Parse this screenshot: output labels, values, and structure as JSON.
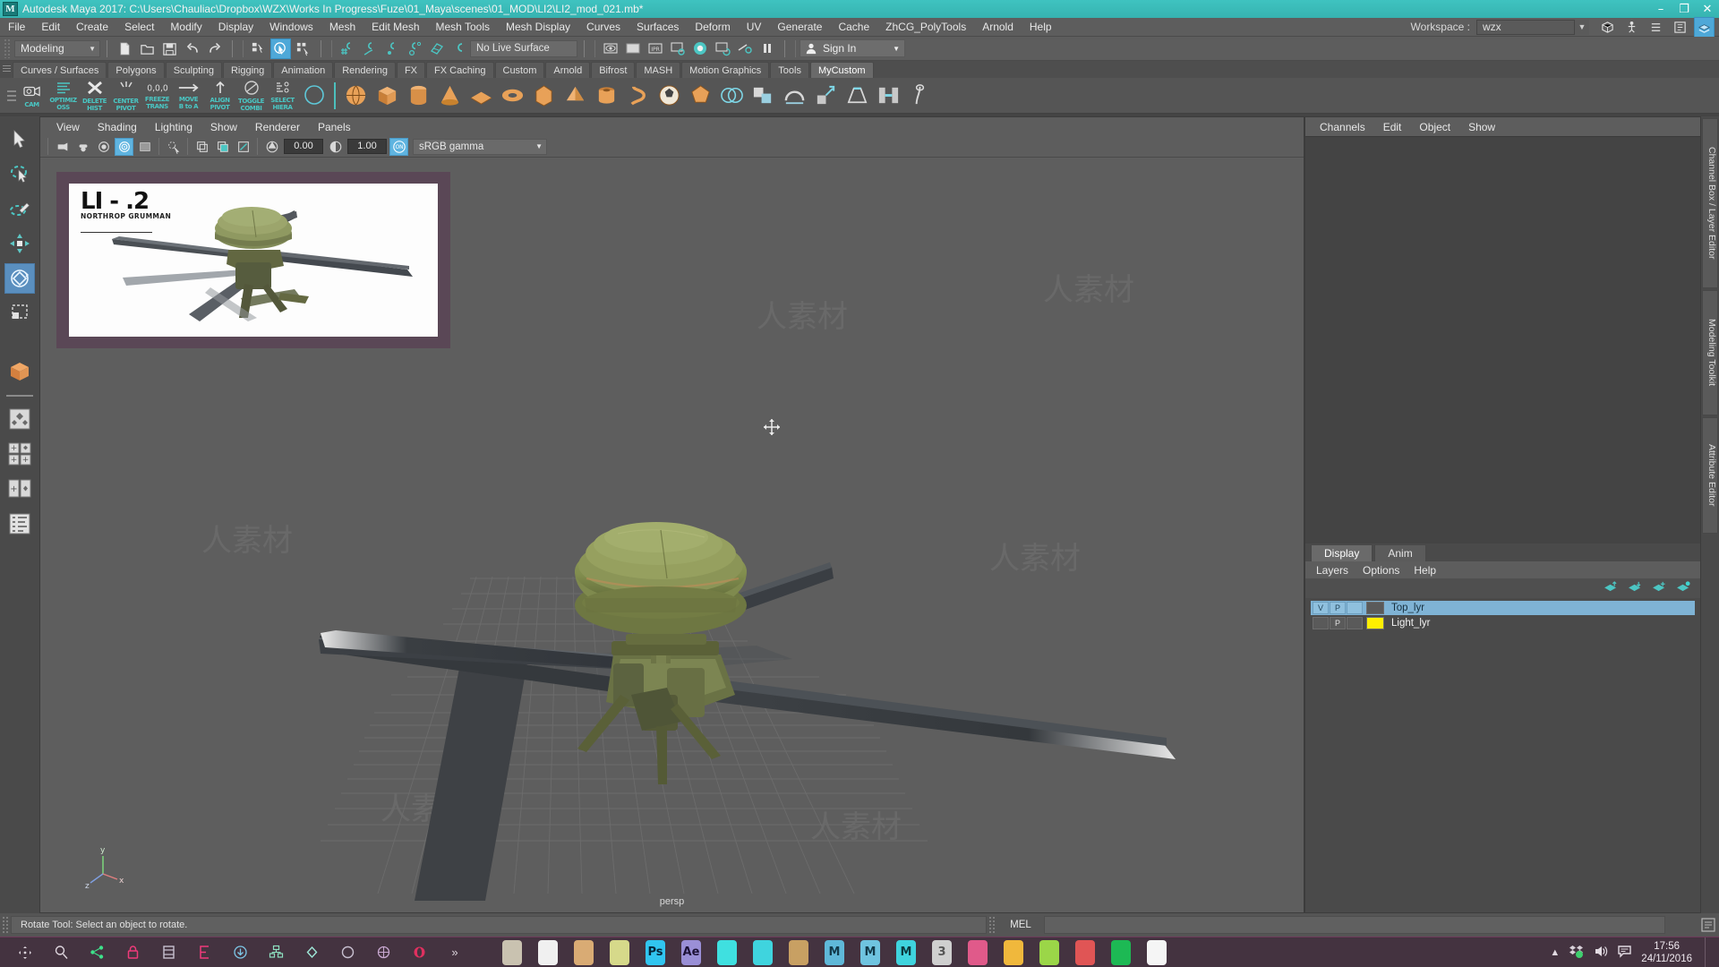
{
  "window": {
    "title": "Autodesk Maya 2017: C:\\Users\\Chauliac\\Dropbox\\WZX\\Works In Progress\\Fuze\\01_Maya\\scenes\\01_MOD\\LI2\\LI2_mod_021.mb*",
    "logo": "M",
    "minimize": "–",
    "maximize": "❐",
    "close": "✕",
    "titlebar_color": "#3cc0bd"
  },
  "menubar": {
    "items": [
      "File",
      "Edit",
      "Create",
      "Select",
      "Modify",
      "Display",
      "Windows",
      "Mesh",
      "Edit Mesh",
      "Mesh Tools",
      "Mesh Display",
      "Curves",
      "Surfaces",
      "Deform",
      "UV",
      "Generate",
      "Cache",
      "ZhCG_PolyTools",
      "Arnold",
      "Help"
    ],
    "workspace_label": "Workspace :",
    "workspace_value": "wzx"
  },
  "statusline": {
    "mode": "Modeling",
    "live_surface": "No Live Surface",
    "sign_in": "Sign In",
    "icons": [
      "new-scene-icon",
      "open-scene-icon",
      "save-scene-icon",
      "undo-icon",
      "redo-icon",
      "select-by-hierarchy-icon",
      "select-by-object-icon",
      "select-by-component-icon",
      "snap-to-grid-icon",
      "snap-to-curve-icon",
      "snap-to-point-icon",
      "snap-to-projected-center-icon",
      "snap-to-view-plane-icon",
      "make-live-icon",
      "render-view-icon",
      "render-region-icon",
      "ipr-render-icon",
      "render-settings-icon",
      "hypershade-icon",
      "render-sequence-icon",
      "toggle-render-icon",
      "pause-icon"
    ]
  },
  "shelf": {
    "tabs": [
      "Curves / Surfaces",
      "Polygons",
      "Sculpting",
      "Rigging",
      "Animation",
      "Rendering",
      "FX",
      "FX Caching",
      "Custom",
      "Arnold",
      "Bifrost",
      "MASH",
      "Motion Graphics",
      "Tools",
      "MyCustom"
    ],
    "active_tab": "MyCustom",
    "buttons": [
      {
        "name": "camera-shelf-button",
        "line1": "CAM",
        "line2": ""
      },
      {
        "name": "optimize-shelf-button",
        "line1": "OPTIMIZ",
        "line2": "OSS"
      },
      {
        "name": "delete-history-shelf-button",
        "line1": "DELETE",
        "line2": "HIST"
      },
      {
        "name": "center-pivot-shelf-button",
        "line1": "CENTER",
        "line2": "PIVOT"
      },
      {
        "name": "freeze-transform-shelf-button",
        "line1": "FREEZE",
        "line2": "TRANS"
      },
      {
        "name": "move-b-to-a-shelf-button",
        "line1": "MOVE",
        "line2": "B to A"
      },
      {
        "name": "align-pivot-shelf-button",
        "line1": "ALIGN",
        "line2": "PIVOT"
      },
      {
        "name": "toggle-combine-shelf-button",
        "line1": "TOGGLE",
        "line2": "COMBI"
      },
      {
        "name": "select-hierarchy-shelf-button",
        "line1": "SELECT",
        "line2": "HIERA"
      },
      {
        "name": "circle-shelf-button",
        "line1": "",
        "line2": ""
      }
    ],
    "primitives": [
      "sphere-icon",
      "cube-icon",
      "cylinder-icon",
      "cone-icon",
      "plane-icon",
      "torus-icon",
      "prism-icon",
      "pyramid-icon",
      "pipe-icon",
      "helix-icon",
      "soccer-ball-icon",
      "platonic-icon",
      "boolean-icon",
      "combine-icon",
      "smooth-icon",
      "extrude-icon",
      "bevel-icon",
      "bridge-icon",
      "sculpt-icon"
    ]
  },
  "toolbox": {
    "tools": [
      {
        "name": "select-tool",
        "icon": "arrow-cursor-icon",
        "selected": false
      },
      {
        "name": "lasso-select-tool",
        "icon": "lasso-icon",
        "selected": false
      },
      {
        "name": "paint-select-tool",
        "icon": "paint-brush-icon",
        "selected": false
      },
      {
        "name": "move-tool",
        "icon": "move-arrows-icon",
        "selected": false
      },
      {
        "name": "rotate-tool",
        "icon": "rotate-rings-icon",
        "selected": true
      },
      {
        "name": "scale-tool",
        "icon": "scale-box-icon",
        "selected": false
      },
      {
        "name": "last-tool-used",
        "icon": "cube-orange-icon",
        "selected": false
      },
      {
        "name": "single-view-layout",
        "icon": "single-pane-icon",
        "selected": false
      },
      {
        "name": "four-view-layout",
        "icon": "four-pane-icon",
        "selected": false
      },
      {
        "name": "two-pane-layout",
        "icon": "two-pane-icon",
        "selected": false
      },
      {
        "name": "outliner-layout",
        "icon": "outliner-icon",
        "selected": false
      }
    ]
  },
  "viewport": {
    "menus": [
      "View",
      "Shading",
      "Lighting",
      "Show",
      "Renderer",
      "Panels"
    ],
    "exposure": "0.00",
    "gamma": "1.00",
    "color_management": "sRGB gamma",
    "camera_label": "persp",
    "axis": {
      "y": "y",
      "x": "x",
      "z": "z"
    },
    "reference_image": {
      "name": "LI - .2",
      "subtitle": "NORTHROP GRUMMAN",
      "border_color": "#5a4756"
    }
  },
  "right_panel": {
    "channelbox_menus": [
      "Channels",
      "Edit",
      "Object",
      "Show"
    ],
    "layer_tabs": [
      "Display",
      "Anim"
    ],
    "active_layer_tab": "Display",
    "layer_menus": [
      "Layers",
      "Options",
      "Help"
    ],
    "layer_tools": [
      "move-layer-up-icon",
      "move-layer-down-icon",
      "new-layer-icon",
      "new-layer-from-selected-icon"
    ],
    "layers": [
      {
        "visible": "V",
        "playback": "P",
        "type": "",
        "color": "#5a5a5a",
        "name": "Top_lyr",
        "selected": true
      },
      {
        "visible": "",
        "playback": "P",
        "type": "",
        "color": "#ffef00",
        "name": "Light_lyr",
        "selected": false
      }
    ]
  },
  "vertical_tabs": [
    "Channel Box / Layer Editor",
    "Modeling Toolkit",
    "Attribute Editor"
  ],
  "command_line": {
    "help_text": "Rotate Tool: Select an object to rotate.",
    "language": "MEL",
    "input_value": "",
    "script_editor_icon": "script-editor-icon"
  },
  "taskbar": {
    "quick_icons": [
      "move-handle-icon",
      "search-icon",
      "share-icon",
      "lock-icon",
      "archive-icon",
      "clipboard-icon",
      "download-icon",
      "network-icon",
      "diamond-icon",
      "magnifier-icon",
      "globe-icon",
      "opera-icon",
      "chevron-expand-icon"
    ],
    "apps": [
      {
        "name": "floppy-save-app",
        "label": "",
        "bg": "#c9c2b0",
        "fg": "#555"
      },
      {
        "name": "chrome-app",
        "label": "",
        "bg": "#f0f0f0",
        "fg": "#4285f4"
      },
      {
        "name": "folder-app",
        "label": "",
        "bg": "#d9ab74",
        "fg": "#6b4a22"
      },
      {
        "name": "moon-app",
        "label": "",
        "bg": "#d6d98a",
        "fg": "#2a2a18"
      },
      {
        "name": "photoshop-app",
        "label": "Ps",
        "bg": "#31c5f0",
        "fg": "#05263b"
      },
      {
        "name": "aftereffects-app",
        "label": "Ae",
        "bg": "#9a8fd6",
        "fg": "#1d1236"
      },
      {
        "name": "opera-app2",
        "label": "",
        "bg": "#3fe0e0",
        "fg": "#0a3b3b"
      },
      {
        "name": "quixel-app",
        "label": "",
        "bg": "#3fd4de",
        "fg": "#0a3636"
      },
      {
        "name": "substance-app",
        "label": "",
        "bg": "#c8a063",
        "fg": "#3a2a0e"
      },
      {
        "name": "maya-app-1",
        "label": "M",
        "bg": "#5fb8d8",
        "fg": "#123a4a"
      },
      {
        "name": "maya-app-2",
        "label": "M",
        "bg": "#6fc4e0",
        "fg": "#123a4a"
      },
      {
        "name": "maya-app-3",
        "label": "M",
        "bg": "#3fd4de",
        "fg": "#0c3b40"
      },
      {
        "name": "3dsmax-app",
        "label": "3",
        "bg": "#cfcfcf",
        "fg": "#555"
      },
      {
        "name": "zbrush-app",
        "label": "",
        "bg": "#e05a8a",
        "fg": "#4a1126"
      },
      {
        "name": "marmoset-app",
        "label": "",
        "bg": "#f0b83c",
        "fg": "#4a3305"
      },
      {
        "name": "evernote-app",
        "label": "",
        "bg": "#9bd648",
        "fg": "#2c4308"
      },
      {
        "name": "bookmark-app",
        "label": "",
        "bg": "#e05555",
        "fg": "#4a0e0e"
      },
      {
        "name": "spotify-app",
        "label": "",
        "bg": "#1db954",
        "fg": "#07290f"
      },
      {
        "name": "anatomy-app",
        "label": "",
        "bg": "#f5f5f5",
        "fg": "#333"
      },
      {
        "name": "opera-app3",
        "label": "",
        "bg": "#443340",
        "fg": "#e0407a"
      }
    ],
    "tray": [
      "show-hidden-icons",
      "dropbox-icon",
      "volume-icon",
      "notifications-icon"
    ],
    "time": "17:56",
    "date": "24/11/2016"
  }
}
